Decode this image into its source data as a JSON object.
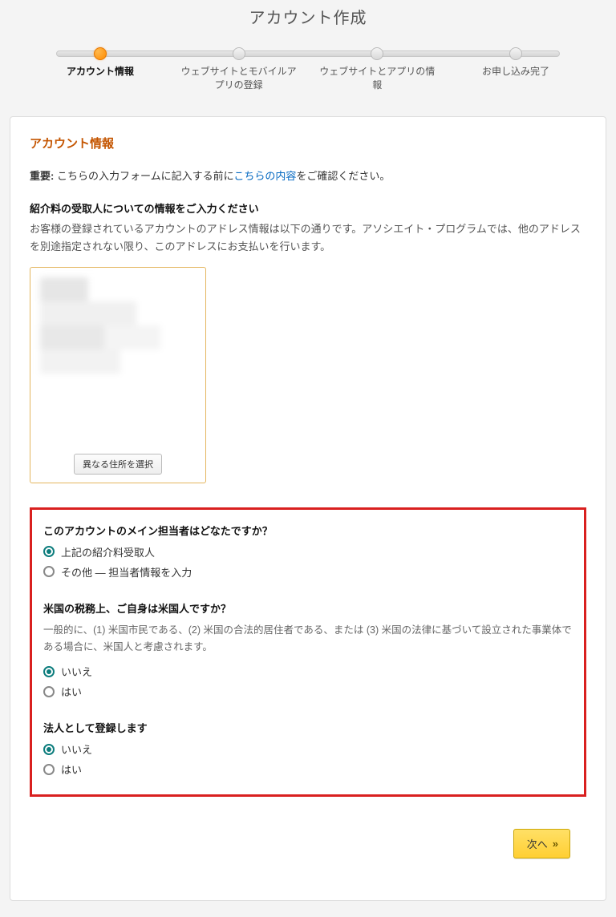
{
  "page_title": "アカウント作成",
  "stepper": {
    "steps": [
      {
        "label": "アカウント情報",
        "active": true
      },
      {
        "label": "ウェブサイトとモバイルアプリの登録",
        "active": false
      },
      {
        "label": "ウェブサイトとアプリの情報",
        "active": false
      },
      {
        "label": "お申し込み完了",
        "active": false
      }
    ]
  },
  "card": {
    "title": "アカウント情報",
    "notice_label": "重要:",
    "notice_before": " こちらの入力フォームに記入する前に",
    "notice_link": "こちらの内容",
    "notice_after": "をご確認ください。",
    "sub_heading": "紹介料の受取人についての情報をご入力ください",
    "sub_desc": "お客様の登録されているアカウントのアドレス情報は以下の通りです。アソシエイト・プログラムでは、他のアドレスを別途指定されない限り、このアドレスにお支払いを行います。",
    "address_button": "異なる住所を選択"
  },
  "questions": {
    "q1": {
      "title": "このアカウントのメイン担当者はどなたですか？",
      "options": [
        {
          "label": "上記の紹介料受取人",
          "checked": true
        },
        {
          "label": "その他 — 担当者情報を入力",
          "checked": false
        }
      ]
    },
    "q2": {
      "title": "米国の税務上、ご自身は米国人ですか？",
      "desc": "一般的に、(1) 米国市民である、(2) 米国の合法的居住者である、または (3) 米国の法律に基づいて設立された事業体である場合に、米国人と考慮されます。",
      "options": [
        {
          "label": "いいえ",
          "checked": true
        },
        {
          "label": "はい",
          "checked": false
        }
      ]
    },
    "q3": {
      "title": "法人として登録します",
      "options": [
        {
          "label": "いいえ",
          "checked": true
        },
        {
          "label": "はい",
          "checked": false
        }
      ]
    }
  },
  "footer": {
    "next": "次へ"
  }
}
